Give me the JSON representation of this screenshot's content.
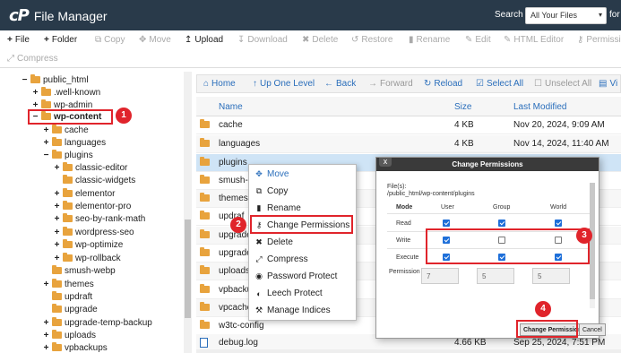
{
  "app": {
    "logo_mark": "cP",
    "title": "File Manager"
  },
  "search": {
    "label": "Search",
    "selected": "All Your Files",
    "for_label": "for"
  },
  "toolbar": {
    "file": "File",
    "folder": "Folder",
    "copy": "Copy",
    "move": "Move",
    "upload": "Upload",
    "download": "Download",
    "delete": "Delete",
    "restore": "Restore",
    "rename": "Rename",
    "edit": "Edit",
    "html_editor": "HTML Editor",
    "permissions": "Permissi",
    "compress": "Compress"
  },
  "tree": {
    "items": [
      {
        "toggle": "−",
        "label": "public_html"
      },
      {
        "toggle": "+",
        "label": ".well-known"
      },
      {
        "toggle": "+",
        "label": "wp-admin"
      },
      {
        "toggle": "−",
        "label": "wp-content"
      },
      {
        "toggle": "+",
        "label": "cache"
      },
      {
        "toggle": "+",
        "label": "languages"
      },
      {
        "toggle": "−",
        "label": "plugins"
      },
      {
        "toggle": "+",
        "label": "classic-editor"
      },
      {
        "toggle": "",
        "label": "classic-widgets"
      },
      {
        "toggle": "+",
        "label": "elementor"
      },
      {
        "toggle": "+",
        "label": "elementor-pro"
      },
      {
        "toggle": "+",
        "label": "seo-by-rank-math"
      },
      {
        "toggle": "+",
        "label": "wordpress-seo"
      },
      {
        "toggle": "+",
        "label": "wp-optimize"
      },
      {
        "toggle": "+",
        "label": "wp-rollback"
      },
      {
        "toggle": "",
        "label": "smush-webp"
      },
      {
        "toggle": "+",
        "label": "themes"
      },
      {
        "toggle": "",
        "label": "updraft"
      },
      {
        "toggle": "",
        "label": "upgrade"
      },
      {
        "toggle": "+",
        "label": "upgrade-temp-backup"
      },
      {
        "toggle": "+",
        "label": "uploads"
      },
      {
        "toggle": "+",
        "label": "vpbackups"
      }
    ]
  },
  "nav": {
    "home": "Home",
    "up": "Up One Level",
    "back": "Back",
    "forward": "Forward",
    "reload": "Reload",
    "select_all": "Select All",
    "unselect_all": "Unselect All",
    "view": "Vi"
  },
  "table": {
    "headers": {
      "name": "Name",
      "size": "Size",
      "modified": "Last Modified"
    },
    "rows": [
      {
        "name": "cache",
        "size": "4 KB",
        "date": "Nov 20, 2024, 9:09 AM"
      },
      {
        "name": "languages",
        "size": "4 KB",
        "date": "Nov 14, 2024, 11:40 AM"
      },
      {
        "name": "plugins",
        "size": "",
        "date": ""
      },
      {
        "name": "smush-",
        "size": "",
        "date": ""
      },
      {
        "name": "themes",
        "size": "",
        "date": ""
      },
      {
        "name": "updraf",
        "size": "",
        "date": ""
      },
      {
        "name": "upgrade",
        "size": "",
        "date": ""
      },
      {
        "name": "upgrade",
        "size": "",
        "date": ""
      },
      {
        "name": "uploads",
        "size": "",
        "date": ""
      },
      {
        "name": "vpbacku",
        "size": "",
        "date": ""
      },
      {
        "name": "vpcache",
        "size": "",
        "date": ""
      },
      {
        "name": "w3tc-config",
        "size": "",
        "date": ""
      },
      {
        "name": "debug.log",
        "size": "4.66 KB",
        "date": "Sep 25, 2024, 7:51 PM"
      }
    ]
  },
  "context_menu": {
    "items": [
      "Move",
      "Copy",
      "Rename",
      "Change Permissions",
      "Delete",
      "Compress",
      "Password Protect",
      "Leech Protect",
      "Manage Indices"
    ]
  },
  "dialog": {
    "title": "Change Permissions",
    "close": "x",
    "file_label": "File(s):",
    "path": "/public_html/wp-content/plugins",
    "col_mode": "Mode",
    "col_user": "User",
    "col_group": "Group",
    "col_world": "World",
    "rows": [
      {
        "label": "Read",
        "user": true,
        "group": true,
        "world": true
      },
      {
        "label": "Write",
        "user": true,
        "group": false,
        "world": false
      },
      {
        "label": "Execute",
        "user": true,
        "group": true,
        "world": true
      }
    ],
    "permission_label": "Permission",
    "values": [
      "7",
      "5",
      "5"
    ],
    "submit": "Change Permissions",
    "cancel": "Cancel"
  },
  "badges": [
    "1",
    "2",
    "3",
    "4"
  ],
  "colors": {
    "header_bg": "#293a4a",
    "accent": "#2a6ebb",
    "highlight": "#e0242b",
    "folder": "#e8a33d",
    "selected_row": "#cfe4f6"
  }
}
